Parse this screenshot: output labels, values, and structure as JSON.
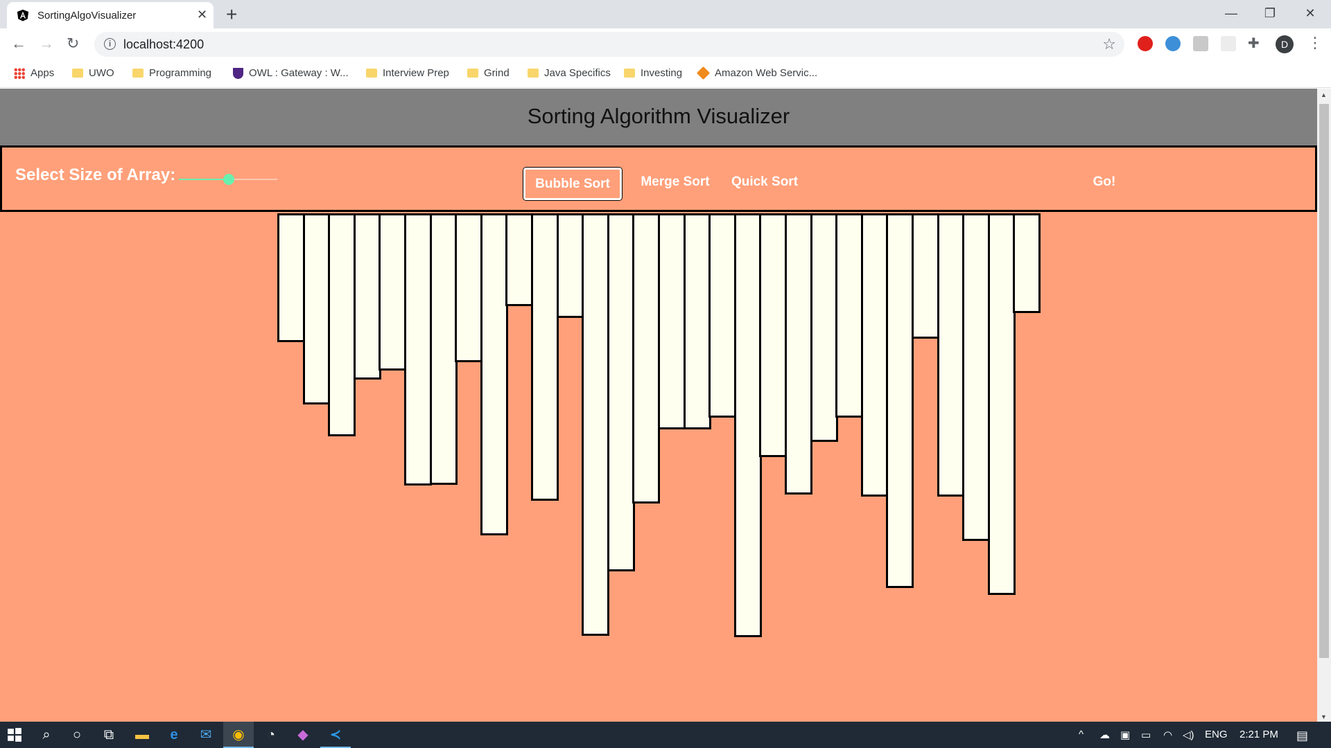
{
  "browser": {
    "tab_title": "SortingAlgoVisualizer",
    "tab_close": "✕",
    "new_tab": "+",
    "url": "localhost:4200",
    "profile_initial": "D",
    "window_controls": {
      "minimize": "—",
      "restore": "❐",
      "close": "✕"
    }
  },
  "bookmarks": [
    {
      "label": "Apps",
      "icon": "apps-grid-icon"
    },
    {
      "label": "UWO",
      "icon": "folder-icon"
    },
    {
      "label": "Programming",
      "icon": "folder-icon"
    },
    {
      "label": "OWL : Gateway : W...",
      "icon": "shield-icon"
    },
    {
      "label": "Interview Prep",
      "icon": "folder-icon"
    },
    {
      "label": "Grind",
      "icon": "folder-icon"
    },
    {
      "label": "Java Specifics",
      "icon": "folder-icon"
    },
    {
      "label": "Investing",
      "icon": "folder-icon"
    },
    {
      "label": "Amazon Web Servic...",
      "icon": "aws-cube-icon"
    }
  ],
  "app": {
    "title": "Sorting Algorithm Visualizer",
    "size_label": "Select Size of Array:",
    "size_slider_fraction": 0.5,
    "algorithms": [
      "Bubble Sort",
      "Merge Sort",
      "Quick Sort"
    ],
    "selected_algorithm": "Bubble Sort",
    "go_label": "Go!",
    "colors": {
      "background": "#ffa07a",
      "header": "#808080",
      "bar_fill": "#fffff0",
      "bar_border": "#000000",
      "slider": "#69f0ae"
    }
  },
  "array_values": [
    186,
    276,
    322,
    240,
    227,
    393,
    392,
    215,
    465,
    134,
    415,
    151,
    610,
    517,
    419,
    312,
    312,
    295,
    612,
    352,
    406,
    330,
    295,
    409,
    541,
    181,
    409,
    473,
    551,
    144
  ],
  "taskbar": {
    "language": "ENG",
    "time": "2:21 PM"
  }
}
